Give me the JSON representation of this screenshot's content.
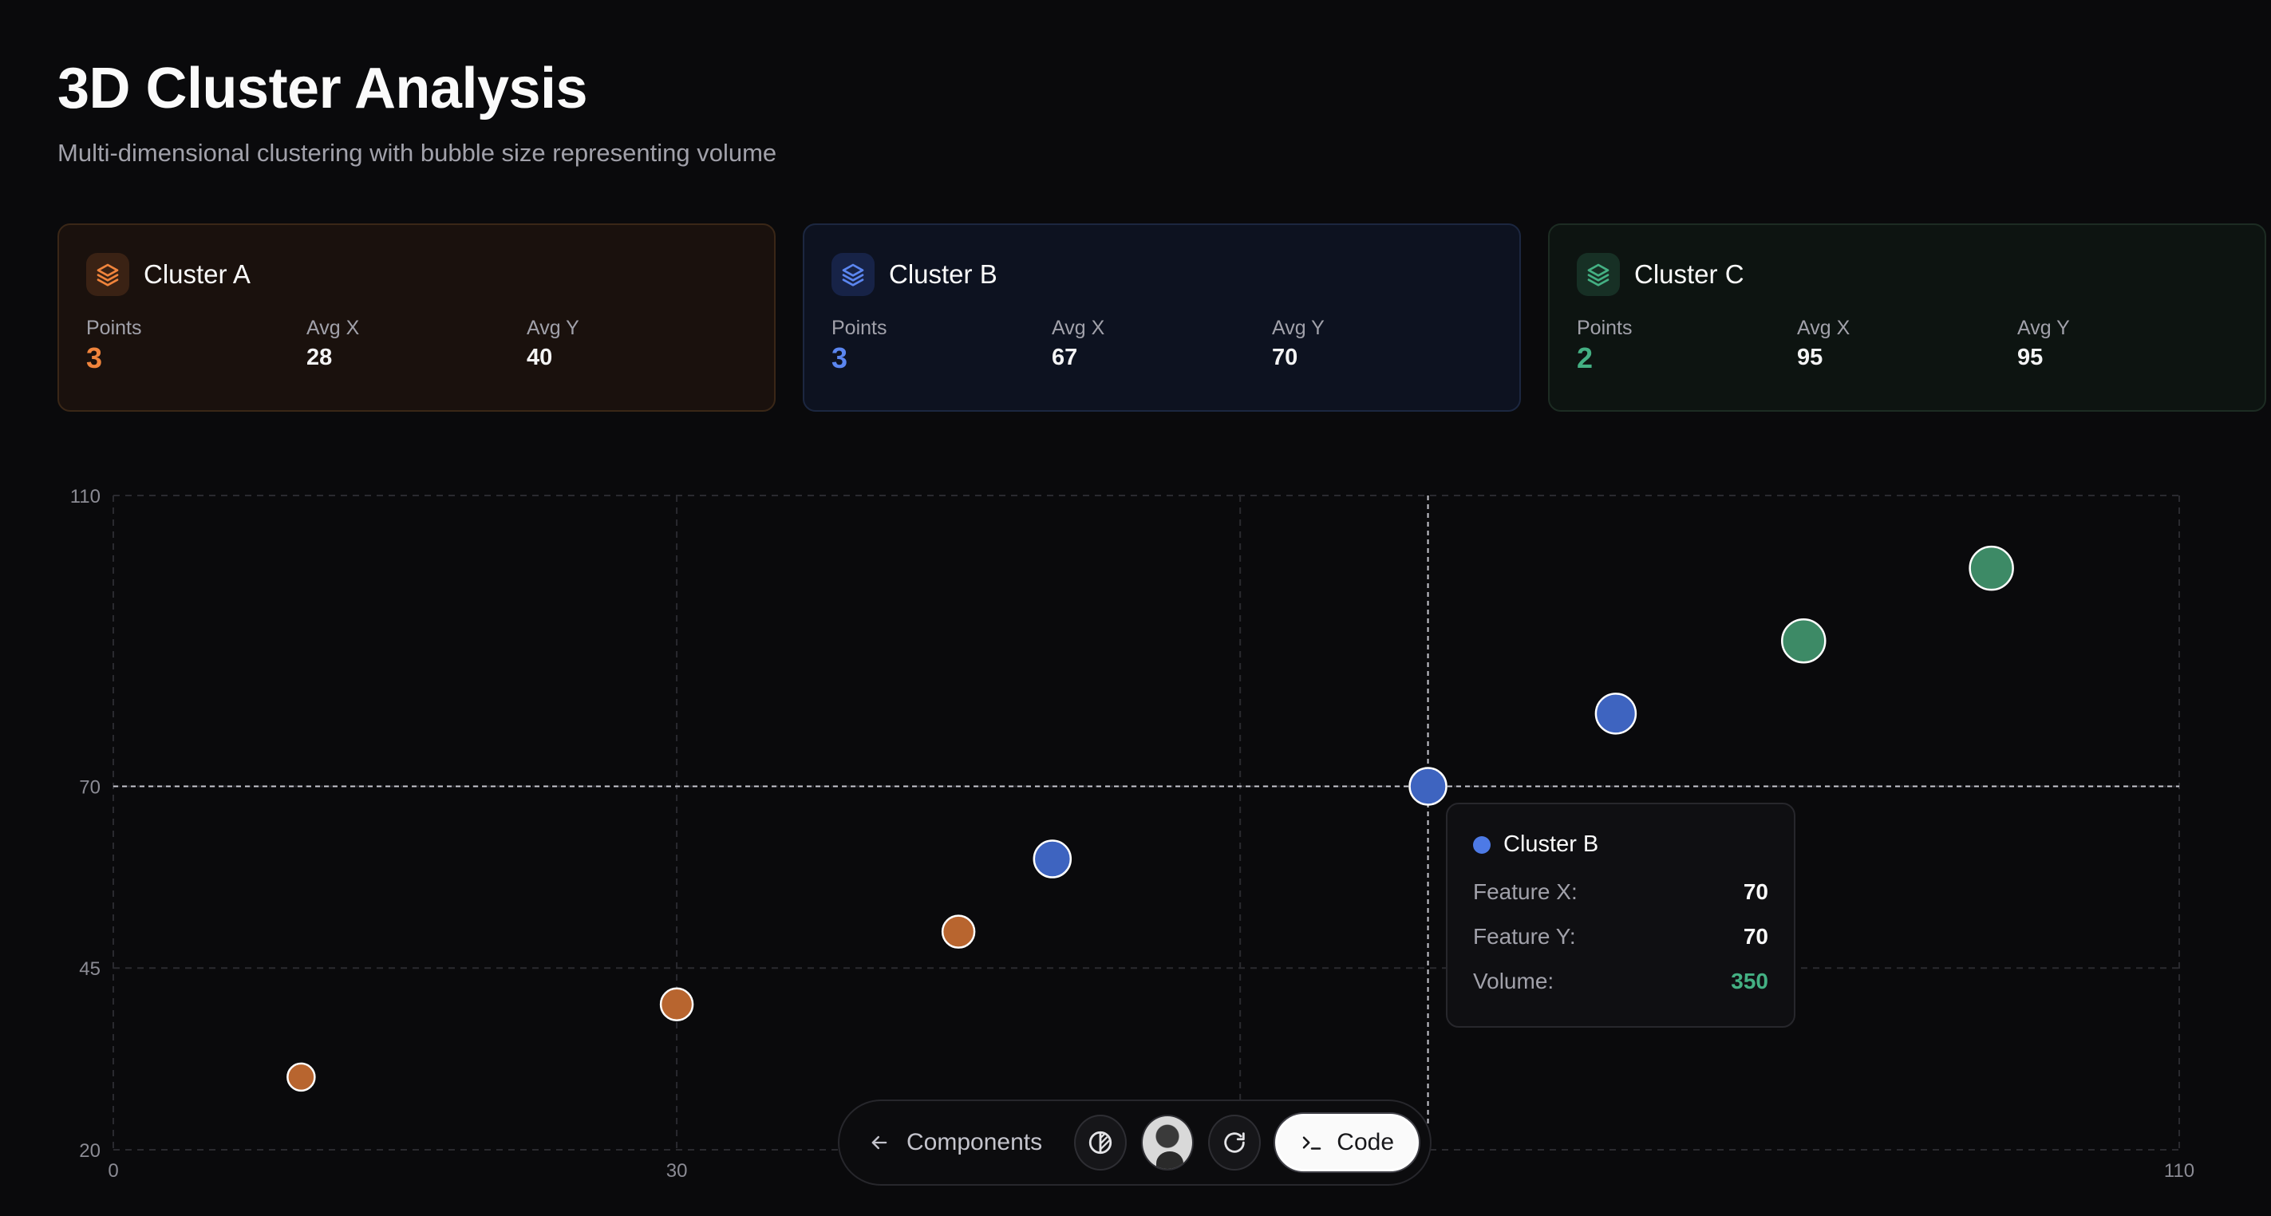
{
  "header": {
    "title": "3D Cluster Analysis",
    "subtitle": "Multi-dimensional clustering with bubble size representing volume"
  },
  "colors": {
    "cluster_a": "#b8652f",
    "cluster_b": "#3e64c0",
    "cluster_c": "#3d8a66",
    "cluster_a_accent": "#f0843c",
    "cluster_b_accent": "#5b86f0",
    "cluster_c_accent": "#44b083"
  },
  "cards": [
    {
      "name": "Cluster A",
      "icon": "layers-icon",
      "points_label": "Points",
      "points": "3",
      "avgx_label": "Avg X",
      "avgx": "28",
      "avgy_label": "Avg Y",
      "avgy": "40"
    },
    {
      "name": "Cluster B",
      "icon": "layers-icon",
      "points_label": "Points",
      "points": "3",
      "avgx_label": "Avg X",
      "avgx": "67",
      "avgy_label": "Avg Y",
      "avgy": "70"
    },
    {
      "name": "Cluster C",
      "icon": "layers-icon",
      "points_label": "Points",
      "points": "2",
      "avgx_label": "Avg X",
      "avgx": "95",
      "avgy_label": "Avg Y",
      "avgy": "95"
    }
  ],
  "chart_data": {
    "type": "scatter",
    "title": "",
    "xlabel": "",
    "ylabel": "",
    "xlim": [
      0,
      110
    ],
    "ylim": [
      20,
      110
    ],
    "x_ticks": [
      "0",
      "30",
      "110"
    ],
    "y_ticks": [
      "20",
      "45",
      "70",
      "110"
    ],
    "grid_x": [
      0,
      30,
      60,
      110
    ],
    "grid_y": [
      20,
      45,
      70,
      110
    ],
    "grid": true,
    "series": [
      {
        "name": "Cluster A",
        "points": [
          {
            "x": 10,
            "y": 30
          },
          {
            "x": 30,
            "y": 40
          },
          {
            "x": 45,
            "y": 50
          }
        ]
      },
      {
        "name": "Cluster B",
        "points": [
          {
            "x": 50,
            "y": 60
          },
          {
            "x": 70,
            "y": 70
          },
          {
            "x": 80,
            "y": 80
          }
        ]
      },
      {
        "name": "Cluster C",
        "points": [
          {
            "x": 90,
            "y": 90
          },
          {
            "x": 100,
            "y": 100
          }
        ]
      }
    ],
    "hover": {
      "x": 70,
      "y": 70
    }
  },
  "tooltip": {
    "title": "Cluster B",
    "rows": [
      {
        "label": "Feature X:",
        "value": "70"
      },
      {
        "label": "Feature Y:",
        "value": "70"
      },
      {
        "label": "Volume:",
        "value": "350"
      }
    ]
  },
  "toolbar": {
    "back_label": "Components",
    "code_label": "Code"
  }
}
